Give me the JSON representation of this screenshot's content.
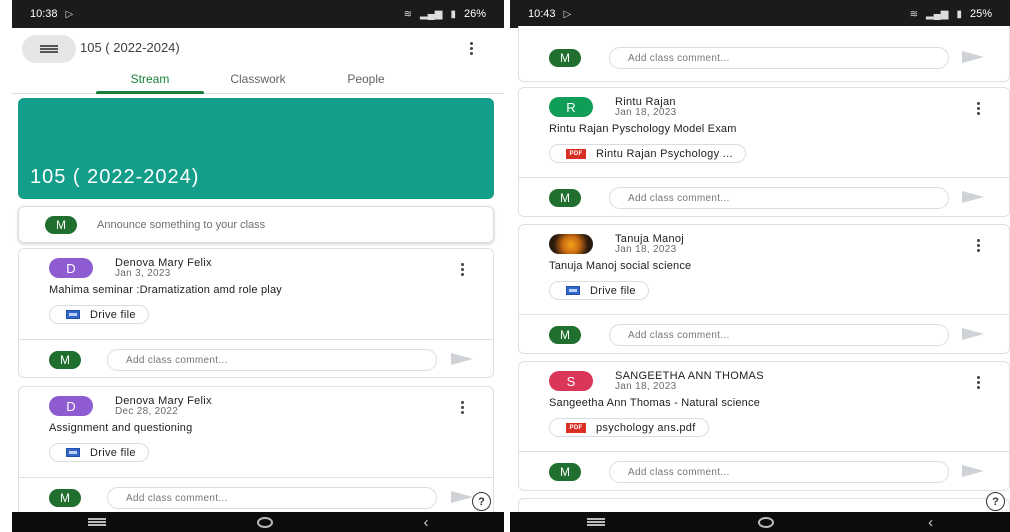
{
  "left": {
    "status": {
      "time": "10:38",
      "battery": "26%"
    },
    "header": {
      "title": "105 ( 2022-2024)"
    },
    "tabs": {
      "stream": "Stream",
      "classwork": "Classwork",
      "people": "People"
    },
    "banner": {
      "title": "105 ( 2022-2024)"
    },
    "announce": {
      "avatar": "M",
      "placeholder": "Announce something to your class"
    },
    "posts": [
      {
        "avatar": "D",
        "author": "Denova Mary Felix",
        "date": "Jan 3, 2023",
        "text": "Mahima seminar :Dramatization amd role play",
        "attachment": "Drive file",
        "comment_avatar": "M",
        "comment_placeholder": "Add class comment..."
      },
      {
        "avatar": "D",
        "author": "Denova Mary Felix",
        "date": "Dec 28, 2022",
        "text": "Assignment and questioning",
        "attachment": "Drive file",
        "comment_avatar": "M",
        "comment_placeholder": "Add class comment..."
      }
    ]
  },
  "right": {
    "status": {
      "time": "10:43",
      "battery": "25%"
    },
    "top_comment": {
      "avatar": "M",
      "placeholder": "Add class comment..."
    },
    "posts": [
      {
        "avatar": "R",
        "author": "Rintu Rajan",
        "date": "Jan 18, 2023",
        "text": "Rintu Rajan Pyschology Model Exam",
        "attachment": "Rintu Rajan Psychology ...",
        "comment_avatar": "M",
        "comment_placeholder": "Add class comment..."
      },
      {
        "avatar": "",
        "author": "Tanuja Manoj",
        "date": "Jan 18, 2023",
        "text": "Tanuja Manoj social science",
        "attachment": "Drive file",
        "comment_avatar": "M",
        "comment_placeholder": "Add class comment..."
      },
      {
        "avatar": "S",
        "author": "SANGEETHA ANN THOMAS",
        "date": "Jan 18, 2023",
        "text": "Sangeetha Ann Thomas - Natural science",
        "attachment": "psychology ans.pdf",
        "comment_avatar": "M",
        "comment_placeholder": "Add class comment..."
      }
    ]
  },
  "icons": {
    "help": "?",
    "pdf": "PDF"
  },
  "colors": {
    "accent_green": "#188038",
    "banner": "#129e89",
    "avatar_d": "#8e5bd1",
    "avatar_r": "#0f9d58",
    "avatar_s": "#d93659",
    "avatar_m": "#206f2e"
  }
}
